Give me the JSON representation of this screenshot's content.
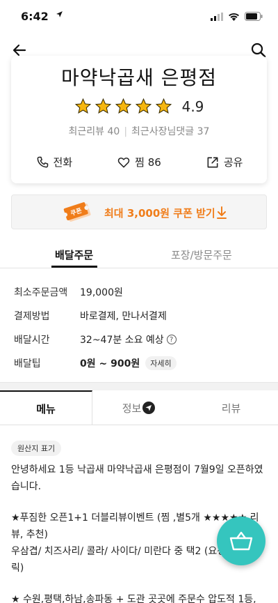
{
  "status": {
    "time": "6:42"
  },
  "store": {
    "name": "마약낙곱새 은평점",
    "rating": "4.9",
    "stars": 5,
    "recent_reviews": "최근리뷰 40",
    "owner_replies": "최근사장님댓글 37",
    "actions": {
      "call": "전화",
      "favorite": "찜 86",
      "share": "공유"
    }
  },
  "coupon": {
    "label": "최대 3,000원 쿠폰 받기",
    "badge_text": "쿠폰"
  },
  "order_tabs": {
    "delivery": "배달주문",
    "pickup": "포장/방문주문"
  },
  "order_info": {
    "min_order_label": "최소주문금액",
    "min_order_value": "19,000원",
    "payment_label": "결제방법",
    "payment_value": "바로결제, 만나서결제",
    "time_label": "배달시간",
    "time_value": "32~47분 소요 예상",
    "tip_label": "배달팁",
    "tip_value": "0원 ~ 900원",
    "tip_detail": "자세히"
  },
  "main_tabs": {
    "menu": "메뉴",
    "info": "정보",
    "review": "리뷰"
  },
  "origin_badge": "원산지 표기",
  "notice": {
    "p1": "안녕하세요 1등 낙곱새 마약낙곱새 은평점이 7월9일 오픈하였습니다.",
    "p2": "★푸짐한 오픈1+1 더블리뷰이벤트 (찜 ,별5개 ★★★★★ 리뷰, 추천)\n   우삼겹/ 치즈사리/ 콜라/ 사이다/ 미란다 중 택2 (요청사항 클릭)",
    "p3": "★ 수원,평택,하남,송파동 + 도관 곳곳에 주문수 압도적 1등,"
  },
  "colors": {
    "accent_orange": "#f07d1a",
    "fab": "#35c5be",
    "star": "#f6b60f"
  }
}
